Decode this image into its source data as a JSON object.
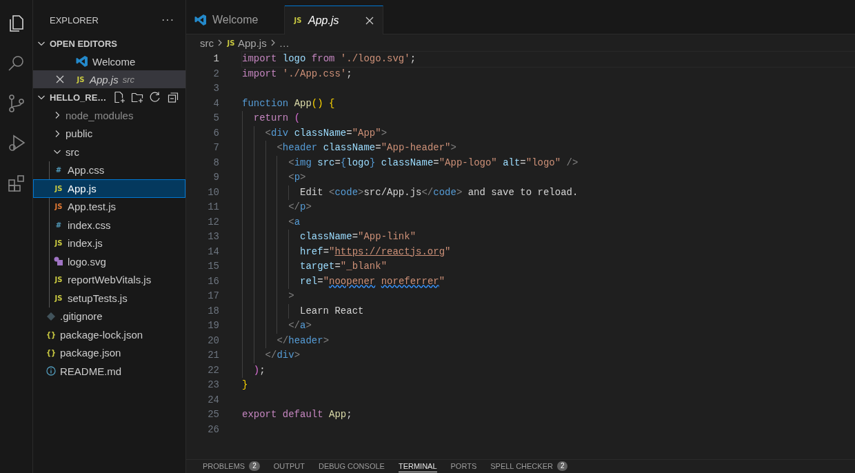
{
  "sidebar": {
    "title": "EXPLORER",
    "more": "···",
    "open_editors": {
      "title": "OPEN EDITORS",
      "expanded": true,
      "items": [
        {
          "label": "Welcome",
          "kind": "vscode",
          "selected": false,
          "preview": false
        },
        {
          "label": "App.js",
          "detail": "src",
          "kind": "glyph",
          "glyph": "JS",
          "color": "#cbcb41",
          "selected": true,
          "preview": true
        }
      ]
    },
    "workspace": {
      "title": "HELLO_RE…",
      "expanded": true,
      "tree": [
        {
          "label": "node_modules",
          "kind": "folder",
          "expanded": false,
          "dimmed": true
        },
        {
          "label": "public",
          "kind": "folder",
          "expanded": false,
          "dimmed": false
        },
        {
          "label": "src",
          "kind": "folder",
          "expanded": true,
          "dimmed": false,
          "children": [
            {
              "label": "App.css",
              "kind": "glyph",
              "glyph": "#",
              "color": "#519aba",
              "selected": false
            },
            {
              "label": "App.js",
              "kind": "glyph",
              "glyph": "JS",
              "color": "#cbcb41",
              "selected": true
            },
            {
              "label": "App.test.js",
              "kind": "glyph",
              "glyph": "JS",
              "color": "#e37933",
              "selected": false
            },
            {
              "label": "index.css",
              "kind": "glyph",
              "glyph": "#",
              "color": "#519aba",
              "selected": false
            },
            {
              "label": "index.js",
              "kind": "glyph",
              "glyph": "JS",
              "color": "#cbcb41",
              "selected": false
            },
            {
              "label": "logo.svg",
              "kind": "image",
              "color": "#a074c4",
              "selected": false
            },
            {
              "label": "reportWebVitals.js",
              "kind": "glyph",
              "glyph": "JS",
              "color": "#cbcb41",
              "selected": false
            },
            {
              "label": "setupTests.js",
              "kind": "glyph",
              "glyph": "JS",
              "color": "#cbcb41",
              "selected": false
            }
          ]
        },
        {
          "label": ".gitignore",
          "kind": "git",
          "color": "#41535b",
          "selected": false
        },
        {
          "label": "package-lock.json",
          "kind": "glyph",
          "glyph": "{}",
          "color": "#cbcb41",
          "selected": false
        },
        {
          "label": "package.json",
          "kind": "glyph",
          "glyph": "{}",
          "color": "#cbcb41",
          "selected": false
        },
        {
          "label": "README.md",
          "kind": "info",
          "color": "#519aba",
          "selected": false
        }
      ]
    }
  },
  "tabs": [
    {
      "label": "Welcome",
      "kind": "vscode",
      "selected": false,
      "preview": false
    },
    {
      "label": "App.js",
      "kind": "glyph",
      "glyph": "JS",
      "color": "#cbcb41",
      "selected": true,
      "preview": true
    }
  ],
  "breadcrumbs": [
    {
      "label": "src"
    },
    {
      "label": "App.js",
      "glyph": "JS",
      "color": "#cbcb41"
    },
    {
      "label": "…"
    }
  ],
  "editor": {
    "lines": [
      {
        "number": "1",
        "active": true,
        "tokens": [
          {
            "kind": "kw",
            "text": "import "
          },
          {
            "kind": "var",
            "text": "logo "
          },
          {
            "kind": "kw",
            "text": "from "
          },
          {
            "kind": "str",
            "text": "'./logo.svg'"
          },
          {
            "kind": "p",
            "text": ";"
          }
        ]
      },
      {
        "number": "2",
        "active": false,
        "tokens": [
          {
            "kind": "kw",
            "text": "import "
          },
          {
            "kind": "str",
            "text": "'./App.css'"
          },
          {
            "kind": "p",
            "text": ";"
          }
        ]
      },
      {
        "number": "3",
        "active": false
      },
      {
        "number": "4",
        "active": false,
        "tokens": [
          {
            "kind": "decl",
            "text": "function "
          },
          {
            "kind": "fn",
            "text": "App"
          },
          {
            "kind": "br",
            "text": "() {"
          }
        ]
      },
      {
        "number": "5",
        "active": false,
        "tokens": [
          {
            "kind": "kw",
            "text": "  return "
          },
          {
            "kind": "br2",
            "text": "("
          }
        ]
      },
      {
        "number": "6",
        "active": false,
        "tokens": [
          {
            "kind": "ang",
            "text": "    <"
          },
          {
            "kind": "tag",
            "text": "div "
          },
          {
            "kind": "var",
            "text": "className"
          },
          {
            "kind": "p",
            "text": "="
          },
          {
            "kind": "str",
            "text": "\"App\""
          },
          {
            "kind": "ang",
            "text": ">"
          }
        ]
      },
      {
        "number": "7",
        "active": false,
        "tokens": [
          {
            "kind": "ang",
            "text": "      <"
          },
          {
            "kind": "tag",
            "text": "header "
          },
          {
            "kind": "var",
            "text": "className"
          },
          {
            "kind": "p",
            "text": "="
          },
          {
            "kind": "str",
            "text": "\"App-header\""
          },
          {
            "kind": "ang",
            "text": ">"
          }
        ]
      },
      {
        "number": "8",
        "active": false,
        "tokens": [
          {
            "kind": "ang",
            "text": "        <"
          },
          {
            "kind": "tag",
            "text": "img "
          },
          {
            "kind": "var",
            "text": "src"
          },
          {
            "kind": "p",
            "text": "="
          },
          {
            "kind": "decl",
            "text": "{"
          },
          {
            "kind": "var",
            "text": "logo"
          },
          {
            "kind": "decl",
            "text": "} "
          },
          {
            "kind": "var",
            "text": "className"
          },
          {
            "kind": "p",
            "text": "="
          },
          {
            "kind": "str",
            "text": "\"App-logo\" "
          },
          {
            "kind": "var",
            "text": "alt"
          },
          {
            "kind": "p",
            "text": "="
          },
          {
            "kind": "str",
            "text": "\"logo\" "
          },
          {
            "kind": "ang",
            "text": "/>"
          }
        ]
      },
      {
        "number": "9",
        "active": false,
        "tokens": [
          {
            "kind": "ang",
            "text": "        <"
          },
          {
            "kind": "tag",
            "text": "p"
          },
          {
            "kind": "ang",
            "text": ">"
          }
        ]
      },
      {
        "number": "10",
        "active": false,
        "tokens": [
          {
            "kind": "p",
            "text": "          Edit "
          },
          {
            "kind": "ang",
            "text": "<"
          },
          {
            "kind": "tag",
            "text": "code"
          },
          {
            "kind": "ang",
            "text": ">"
          },
          {
            "kind": "p",
            "text": "src/App.js"
          },
          {
            "kind": "ang",
            "text": "</"
          },
          {
            "kind": "tag",
            "text": "code"
          },
          {
            "kind": "ang",
            "text": ">"
          },
          {
            "kind": "p",
            "text": " and save to reload."
          }
        ]
      },
      {
        "number": "11",
        "active": false,
        "tokens": [
          {
            "kind": "ang",
            "text": "        </"
          },
          {
            "kind": "tag",
            "text": "p"
          },
          {
            "kind": "ang",
            "text": ">"
          }
        ]
      },
      {
        "number": "12",
        "active": false,
        "tokens": [
          {
            "kind": "ang",
            "text": "        <"
          },
          {
            "kind": "tag",
            "text": "a"
          }
        ]
      },
      {
        "number": "13",
        "active": false,
        "tokens": [
          {
            "kind": "var",
            "text": "          className"
          },
          {
            "kind": "p",
            "text": "="
          },
          {
            "kind": "str",
            "text": "\"App-link\""
          }
        ]
      },
      {
        "number": "14",
        "active": false,
        "tokens": [
          {
            "kind": "var",
            "text": "          href"
          },
          {
            "kind": "p",
            "text": "="
          },
          {
            "kind": "str",
            "text": "\""
          },
          {
            "kind": "link",
            "text": "https://reactjs.org"
          },
          {
            "kind": "str",
            "text": "\""
          }
        ]
      },
      {
        "number": "15",
        "active": false,
        "tokens": [
          {
            "kind": "var",
            "text": "          target"
          },
          {
            "kind": "p",
            "text": "="
          },
          {
            "kind": "str",
            "text": "\"_blank\""
          }
        ]
      },
      {
        "number": "16",
        "active": false,
        "tokens": [
          {
            "kind": "var",
            "text": "          rel"
          },
          {
            "kind": "p",
            "text": "="
          },
          {
            "kind": "str",
            "text": "\""
          },
          {
            "kind": "squiggle",
            "text": "noopener"
          },
          {
            "kind": "squiggle",
            "text": " noreferrer"
          },
          {
            "kind": "str",
            "text": "\""
          }
        ]
      },
      {
        "number": "17",
        "active": false,
        "tokens": [
          {
            "kind": "ang",
            "text": "        >"
          }
        ]
      },
      {
        "number": "18",
        "active": false,
        "tokens": [
          {
            "kind": "p",
            "text": "          Learn React"
          }
        ]
      },
      {
        "number": "19",
        "active": false,
        "tokens": [
          {
            "kind": "ang",
            "text": "        </"
          },
          {
            "kind": "tag",
            "text": "a"
          },
          {
            "kind": "ang",
            "text": ">"
          }
        ]
      },
      {
        "number": "20",
        "active": false,
        "tokens": [
          {
            "kind": "ang",
            "text": "      </"
          },
          {
            "kind": "tag",
            "text": "header"
          },
          {
            "kind": "ang",
            "text": ">"
          }
        ]
      },
      {
        "number": "21",
        "active": false,
        "tokens": [
          {
            "kind": "ang",
            "text": "    </"
          },
          {
            "kind": "tag",
            "text": "div"
          },
          {
            "kind": "ang",
            "text": ">"
          }
        ]
      },
      {
        "number": "22",
        "active": false,
        "tokens": [
          {
            "kind": "br2",
            "text": "  )"
          },
          {
            "kind": "p",
            "text": ";"
          }
        ]
      },
      {
        "number": "23",
        "active": false,
        "tokens": [
          {
            "kind": "br",
            "text": "}"
          }
        ]
      },
      {
        "number": "24",
        "active": false
      },
      {
        "number": "25",
        "active": false,
        "tokens": [
          {
            "kind": "kw",
            "text": "export default "
          },
          {
            "kind": "fn",
            "text": "App"
          },
          {
            "kind": "p",
            "text": ";"
          }
        ]
      },
      {
        "number": "26",
        "active": false
      }
    ]
  },
  "panel": {
    "tabs": [
      {
        "label": "PROBLEMS",
        "badge": "2",
        "selected": false
      },
      {
        "label": "OUTPUT",
        "selected": false
      },
      {
        "label": "DEBUG CONSOLE",
        "selected": false
      },
      {
        "label": "TERMINAL",
        "selected": true
      },
      {
        "label": "PORTS",
        "selected": false
      },
      {
        "label": "SPELL CHECKER",
        "badge": "2",
        "selected": false
      }
    ]
  }
}
